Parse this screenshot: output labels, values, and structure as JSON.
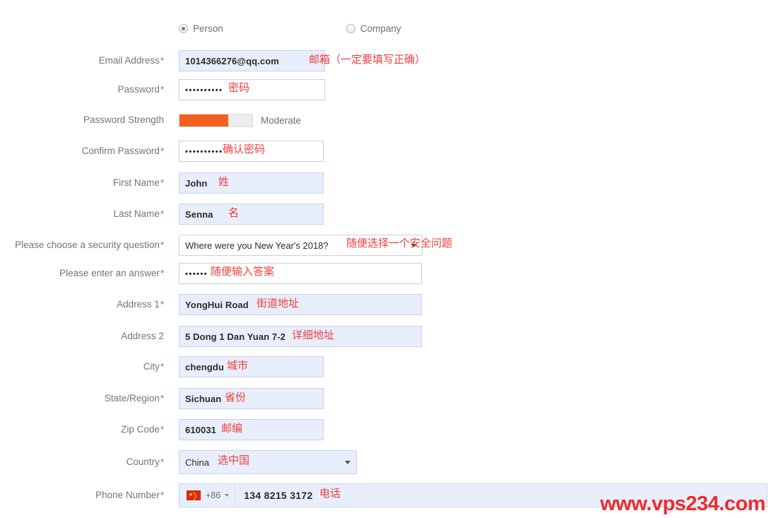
{
  "account_type": {
    "options": [
      {
        "label": "Person",
        "selected": true
      },
      {
        "label": "Company",
        "selected": false
      }
    ]
  },
  "fields": {
    "email": {
      "label": "Email Address",
      "required": "*",
      "value": "1014366276@qq.com",
      "annotation": "邮箱（一定要填写正确）"
    },
    "password": {
      "label": "Password",
      "required": "*",
      "value": "••••••••••",
      "annotation": "密码"
    },
    "password_strength": {
      "label": "Password Strength",
      "required": "",
      "level_text": "Moderate",
      "percent": 67,
      "fill_color": "#f4601f",
      "track_color": "#ececec"
    },
    "confirm_password": {
      "label": "Confirm Password",
      "required": "*",
      "value": "••••••••••",
      "annotation": "确认密码"
    },
    "first_name": {
      "label": "First Name",
      "required": "*",
      "value": "John",
      "annotation": "姓"
    },
    "last_name": {
      "label": "Last Name",
      "required": "*",
      "value": "Senna",
      "annotation": "名"
    },
    "security_question": {
      "label": "Please choose a security question",
      "required": "*",
      "value": "Where were you New Year's 2018?",
      "annotation": "随便选择一个安全问题"
    },
    "security_answer": {
      "label": "Please enter an answer",
      "required": "*",
      "value": "••••••",
      "annotation": "随便输入答案"
    },
    "address1": {
      "label": "Address 1",
      "required": "*",
      "value": "YongHui Road",
      "annotation": "街道地址"
    },
    "address2": {
      "label": "Address 2",
      "required": "",
      "value": "5 Dong 1 Dan Yuan 7-2",
      "annotation": "详细地址"
    },
    "city": {
      "label": "City",
      "required": "*",
      "value": "chengdu",
      "annotation": "城市"
    },
    "state": {
      "label": "State/Region",
      "required": "*",
      "value": "Sichuan",
      "annotation": "省份"
    },
    "zip": {
      "label": "Zip Code",
      "required": "*",
      "value": "610031",
      "annotation": "邮编"
    },
    "country": {
      "label": "Country",
      "required": "*",
      "value": "China",
      "annotation": "选中国"
    },
    "phone": {
      "label": "Phone Number",
      "required": "*",
      "dial_code": "+86",
      "flag": "cn-flag-icon",
      "value": "134 8215 3172",
      "annotation": "电话"
    }
  },
  "watermark": "www.vps234.com",
  "colors": {
    "required_asterisk": "#e8423f",
    "annotation": "#ef3e3e",
    "autofill_bg": "#e8eefb",
    "strength_orange": "#f4601f",
    "watermark": "#ee2b2b"
  }
}
